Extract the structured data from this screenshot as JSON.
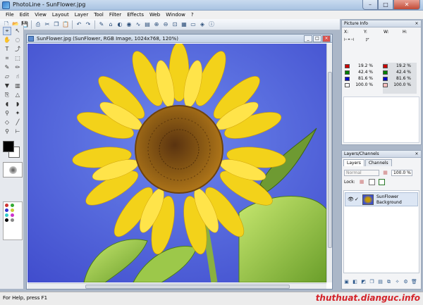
{
  "app": {
    "title": "PhotoLine - SunFlower.jpg"
  },
  "window_buttons": {
    "minimize": "–",
    "maximize": "□",
    "close": "✕"
  },
  "menu": [
    "File",
    "Edit",
    "View",
    "Layout",
    "Layer",
    "Tool",
    "Filter",
    "Effects",
    "Web",
    "Window",
    "?"
  ],
  "toolbar_icons": [
    "new-icon",
    "open-icon",
    "save-icon",
    "print-icon",
    "cut-icon",
    "copy-icon",
    "paste-icon",
    "undo-icon",
    "redo-icon",
    "zoom-in-icon",
    "zoom-out-icon",
    "zoom-fit-icon"
  ],
  "document": {
    "title": "SunFlower.jpg  (SunFlower, RGB Image, 1024x768, 120%)",
    "buttons": {
      "minimize": "_",
      "maximize": "□",
      "close": "×"
    }
  },
  "picture_info": {
    "title": "Picture Info",
    "close": "×",
    "coord_labels": {
      "x": "X:",
      "y": "Y:",
      "w": "W:",
      "h": "H:"
    },
    "left_channels": [
      {
        "color": "#cc0000",
        "value": "19.2 %"
      },
      {
        "color": "#008000",
        "value": "42.4 %"
      },
      {
        "color": "#0000cc",
        "value": "81.6 %"
      },
      {
        "color": "#ffffff",
        "value": "100.0 %"
      }
    ],
    "right_channels": [
      {
        "color": "#cc0000",
        "value": "19.2 %"
      },
      {
        "color": "#008000",
        "value": "42.4 %"
      },
      {
        "color": "#0000cc",
        "value": "81.6 %"
      },
      {
        "color": "#ffc0c0",
        "value": "100.0 %"
      }
    ]
  },
  "layers_panel": {
    "title": "Layers/Channels",
    "close": "×",
    "tabs": [
      "Layers",
      "Channels"
    ],
    "blend_mode": "Normal",
    "opacity": "100.0 %",
    "lock_label": "Lock:",
    "layer": {
      "name_line1": "SunFlower",
      "name_line2": "Background"
    }
  },
  "status": {
    "text": "For Help, press F1",
    "watermark": "thuthuat.dianguc.info"
  }
}
